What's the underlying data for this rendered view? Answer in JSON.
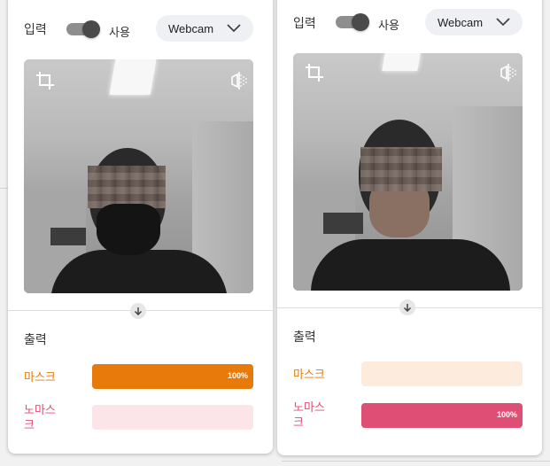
{
  "colors": {
    "mask_accent": "#e8790b",
    "mask_track": "#fdebde",
    "nomask_accent": "#df4e74",
    "nomask_track": "#fce5e8"
  },
  "panels": [
    {
      "input_label": "입력",
      "toggle_on": true,
      "use_label": "사용",
      "source_select": "Webcam",
      "output_label": "출력",
      "classes": [
        {
          "label": "마스크",
          "percent": 100,
          "percent_label": "100%"
        },
        {
          "label": "노마스크",
          "percent": 0,
          "percent_label": ""
        }
      ]
    },
    {
      "input_label": "입력",
      "toggle_on": true,
      "use_label": "사용",
      "source_select": "Webcam",
      "output_label": "출력",
      "classes": [
        {
          "label": "마스크",
          "percent": 0,
          "percent_label": ""
        },
        {
          "label": "노마스크",
          "percent": 100,
          "percent_label": "100%"
        }
      ]
    }
  ],
  "icons": [
    "crop-icon",
    "flip-icon",
    "chevron-down-icon",
    "arrow-down-icon"
  ]
}
